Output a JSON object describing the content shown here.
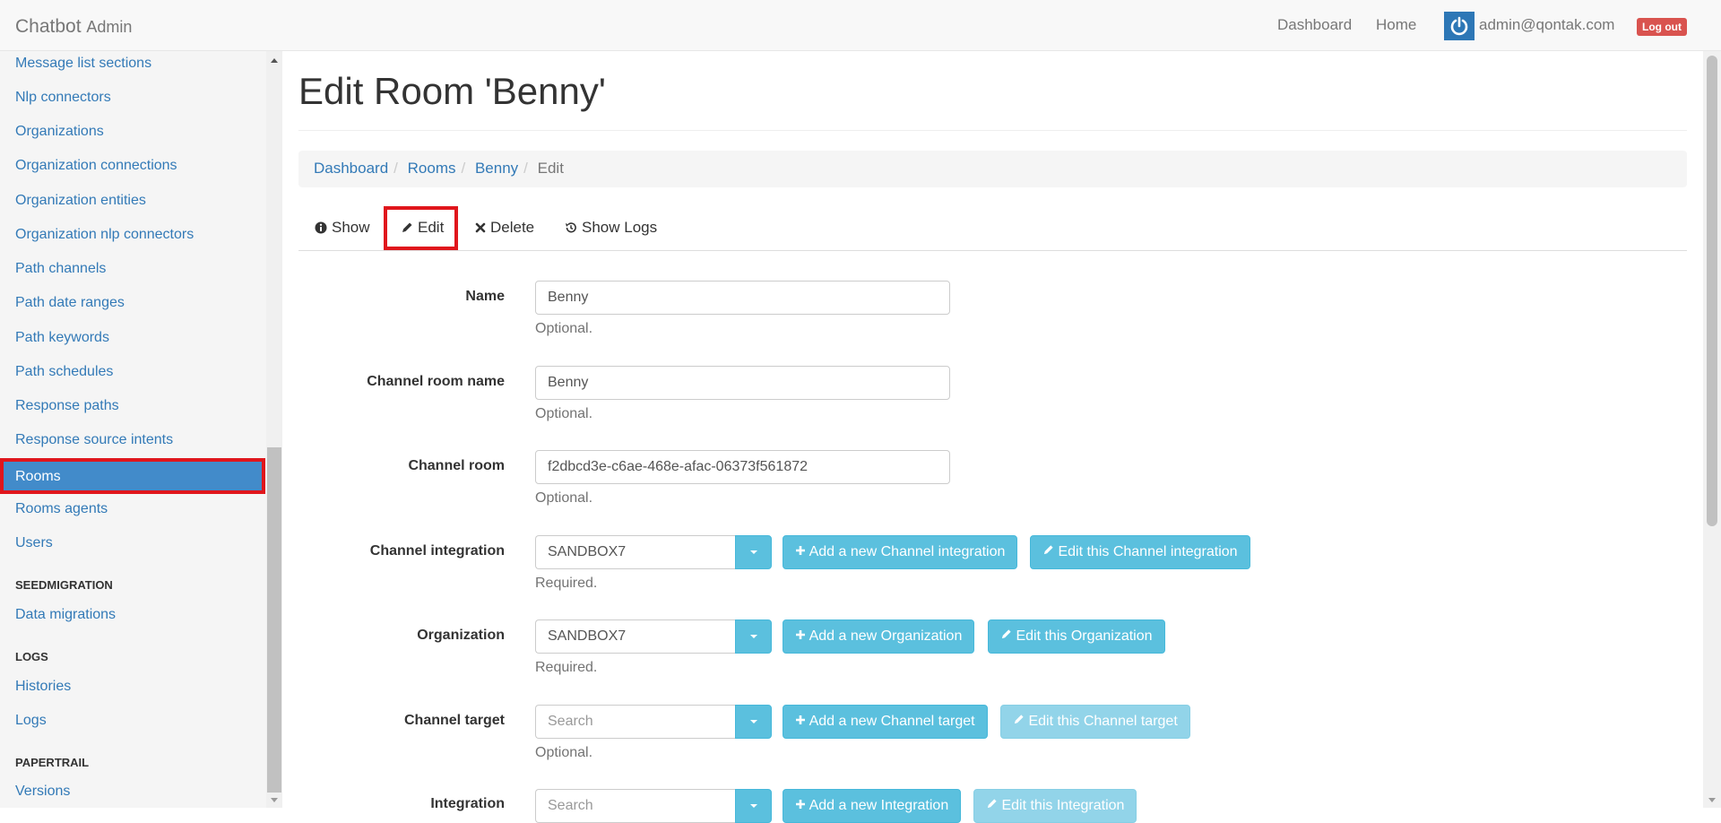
{
  "navbar": {
    "brand": "Chatbot",
    "brand_sub": "Admin",
    "links": [
      "Dashboard",
      "Home"
    ],
    "user_email": "admin@qontak.com",
    "logout_label": "Log out"
  },
  "sidebar": {
    "items_top": [
      "Message list sections",
      "Nlp connectors",
      "Organizations",
      "Organization connections",
      "Organization entities",
      "Organization nlp connectors",
      "Path channels",
      "Path date ranges",
      "Path keywords",
      "Path schedules",
      "Response paths",
      "Response source intents"
    ],
    "active_item": "Rooms",
    "items_after": [
      "Rooms agents",
      "Users"
    ],
    "sections": [
      {
        "header": "SEEDMIGRATION",
        "items": [
          "Data migrations"
        ]
      },
      {
        "header": "LOGS",
        "items": [
          "Histories",
          "Logs"
        ]
      },
      {
        "header": "PAPERTRAIL",
        "items": [
          "Versions"
        ]
      }
    ]
  },
  "page": {
    "title": "Edit Room 'Benny'",
    "breadcrumb": [
      "Dashboard",
      "Rooms",
      "Benny",
      "Edit"
    ],
    "tabs": [
      "Show",
      "Edit",
      "Delete",
      "Show Logs"
    ]
  },
  "form": {
    "name": {
      "label": "Name",
      "value": "Benny",
      "help": "Optional."
    },
    "channel_room_name": {
      "label": "Channel room name",
      "value": "Benny",
      "help": "Optional."
    },
    "channel_room": {
      "label": "Channel room",
      "value": "f2dbcd3e-c6ae-468e-afac-06373f561872",
      "help": "Optional."
    },
    "channel_integration": {
      "label": "Channel integration",
      "value": "SANDBOX7",
      "help": "Required.",
      "add_label": "Add a new Channel integration",
      "edit_label": "Edit this Channel integration"
    },
    "organization": {
      "label": "Organization",
      "value": "SANDBOX7",
      "help": "Required.",
      "add_label": "Add a new Organization",
      "edit_label": "Edit this Organization"
    },
    "channel_target": {
      "label": "Channel target",
      "placeholder": "Search",
      "help": "Optional.",
      "add_label": "Add a new Channel target",
      "edit_label": "Edit this Channel target"
    },
    "integration": {
      "label": "Integration",
      "placeholder": "Search",
      "add_label": "Add a new Integration",
      "edit_label": "Edit this Integration"
    }
  },
  "colors": {
    "link": "#337ab7",
    "active_bg": "#428bca",
    "highlight_border": "#e0161c",
    "info_button": "#5bc0de",
    "logout": "#d9534f"
  }
}
